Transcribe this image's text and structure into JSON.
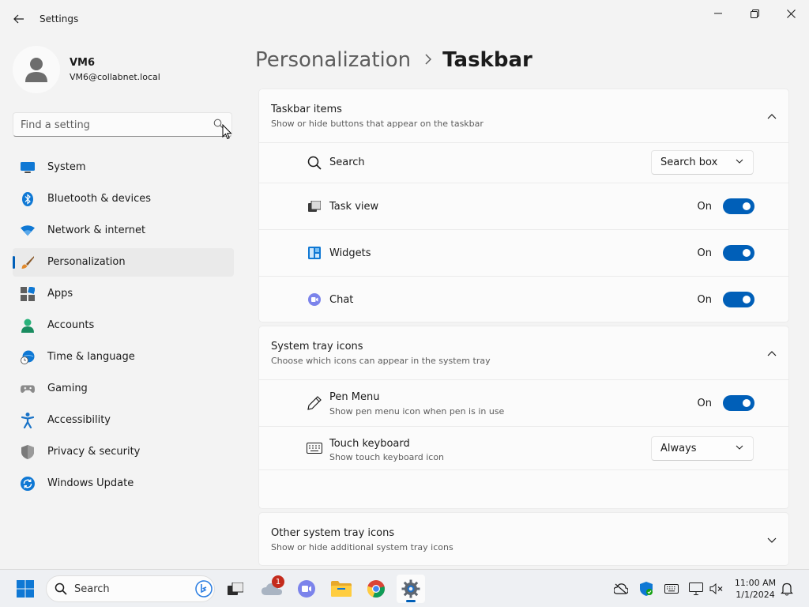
{
  "window": {
    "title": "Settings"
  },
  "profile": {
    "name": "VM6",
    "email": "VM6@collabnet.local"
  },
  "search": {
    "placeholder": "Find a setting"
  },
  "nav": {
    "items": [
      {
        "label": "System",
        "icon": "monitor-icon"
      },
      {
        "label": "Bluetooth & devices",
        "icon": "bluetooth-icon"
      },
      {
        "label": "Network & internet",
        "icon": "wifi-icon"
      },
      {
        "label": "Personalization",
        "icon": "brush-icon",
        "active": true
      },
      {
        "label": "Apps",
        "icon": "apps-icon"
      },
      {
        "label": "Accounts",
        "icon": "person-icon"
      },
      {
        "label": "Time & language",
        "icon": "globe-clock-icon"
      },
      {
        "label": "Gaming",
        "icon": "gamepad-icon"
      },
      {
        "label": "Accessibility",
        "icon": "accessibility-icon"
      },
      {
        "label": "Privacy & security",
        "icon": "shield-icon"
      },
      {
        "label": "Windows Update",
        "icon": "update-icon"
      }
    ]
  },
  "breadcrumb": {
    "parent": "Personalization",
    "current": "Taskbar"
  },
  "taskbar_items": {
    "title": "Taskbar items",
    "subtitle": "Show or hide buttons that appear on the taskbar",
    "search": {
      "label": "Search",
      "value": "Search box"
    },
    "task_view": {
      "label": "Task view",
      "state": "On"
    },
    "widgets": {
      "label": "Widgets",
      "state": "On"
    },
    "chat": {
      "label": "Chat",
      "state": "On"
    }
  },
  "system_tray": {
    "title": "System tray icons",
    "subtitle": "Choose which icons can appear in the system tray",
    "pen_menu": {
      "label": "Pen Menu",
      "subtitle": "Show pen menu icon when pen is in use",
      "state": "On"
    },
    "touch_keyboard": {
      "label": "Touch keyboard",
      "subtitle": "Show touch keyboard icon",
      "value": "Always"
    }
  },
  "other_tray": {
    "title": "Other system tray icons",
    "subtitle": "Show or hide additional system tray icons"
  },
  "taskbar": {
    "search_label": "Search",
    "onedrive_badge": "1",
    "time": "11:00 AM",
    "date": "1/1/2024"
  },
  "colors": {
    "accent": "#005fb8",
    "background": "#f3f3f3",
    "card": "#fbfbfb"
  }
}
